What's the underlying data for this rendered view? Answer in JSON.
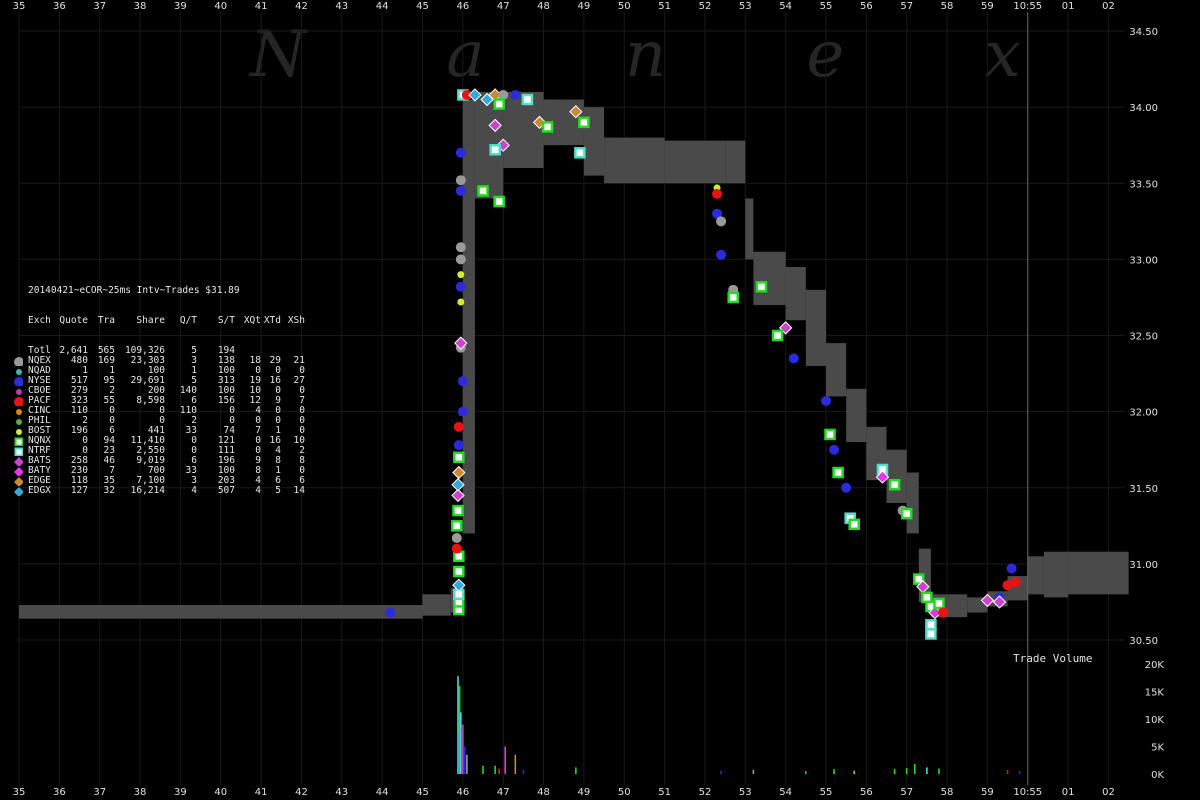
{
  "watermark": "N a n e x",
  "table": {
    "title": "20140421~eCOR~25ms Intv~Trades $31.89",
    "header": [
      "Exch",
      "Quote",
      "Tra",
      "Share",
      "Q/T",
      "S/T",
      "XQt",
      "XTd",
      "XSh"
    ],
    "rows": [
      {
        "name": "Totl",
        "cells": [
          "2,641",
          "565",
          "109,326",
          "5",
          "194",
          "",
          "",
          ""
        ],
        "color": "",
        "shape": "none"
      },
      {
        "name": "NQEX",
        "cells": [
          "480",
          "169",
          "23,303",
          "3",
          "138",
          "18",
          "29",
          "21"
        ],
        "color": "#9a9a9a",
        "shape": "circle-lg"
      },
      {
        "name": "NQAD",
        "cells": [
          "1",
          "1",
          "100",
          "1",
          "100",
          "0",
          "0",
          "0"
        ],
        "color": "#33bbbb",
        "shape": "circle-sm"
      },
      {
        "name": "NYSE",
        "cells": [
          "517",
          "95",
          "29,691",
          "5",
          "313",
          "19",
          "16",
          "27"
        ],
        "color": "#2b2bdd",
        "shape": "circle-lg"
      },
      {
        "name": "CBOE",
        "cells": [
          "279",
          "2",
          "200",
          "140",
          "100",
          "10",
          "0",
          "0"
        ],
        "color": "#aa44aa",
        "shape": "circle-sm"
      },
      {
        "name": "PACF",
        "cells": [
          "323",
          "55",
          "8,598",
          "6",
          "156",
          "12",
          "9",
          "7"
        ],
        "color": "#ee1111",
        "shape": "circle-lg"
      },
      {
        "name": "CINC",
        "cells": [
          "110",
          "0",
          "0",
          "110",
          "0",
          "4",
          "0",
          "0"
        ],
        "color": "#dd8800",
        "shape": "circle-sm"
      },
      {
        "name": "PHIL",
        "cells": [
          "2",
          "0",
          "0",
          "2",
          "0",
          "0",
          "0",
          "0"
        ],
        "color": "#55aa55",
        "shape": "circle-sm"
      },
      {
        "name": "BOST",
        "cells": [
          "196",
          "6",
          "441",
          "33",
          "74",
          "7",
          "1",
          "0"
        ],
        "color": "#ccee33",
        "shape": "circle-sm"
      },
      {
        "name": "NQNX",
        "cells": [
          "0",
          "94",
          "11,410",
          "0",
          "121",
          "0",
          "16",
          "10"
        ],
        "color": "#22dd22",
        "shape": "square"
      },
      {
        "name": "NTRF",
        "cells": [
          "0",
          "23",
          "2,550",
          "0",
          "111",
          "0",
          "4",
          "2"
        ],
        "color": "#55ddcc",
        "shape": "square"
      },
      {
        "name": "BATS",
        "cells": [
          "258",
          "46",
          "9,019",
          "6",
          "196",
          "9",
          "8",
          "8"
        ],
        "color": "#cc44cc",
        "shape": "diamond"
      },
      {
        "name": "BATY",
        "cells": [
          "230",
          "7",
          "700",
          "33",
          "100",
          "8",
          "1",
          "0"
        ],
        "color": "#ee33ee",
        "shape": "diamond"
      },
      {
        "name": "EDGE",
        "cells": [
          "118",
          "35",
          "7,100",
          "3",
          "203",
          "4",
          "6",
          "6"
        ],
        "color": "#cc8833",
        "shape": "diamond"
      },
      {
        "name": "EDGX",
        "cells": [
          "127",
          "32",
          "16,214",
          "4",
          "507",
          "4",
          "5",
          "14"
        ],
        "color": "#33aadd",
        "shape": "diamond"
      }
    ]
  },
  "volume_label": "Trade Volume",
  "chart_data": {
    "type": "scatter",
    "title": "20140421~eCOR~25ms Intv~Trades $31.89",
    "x_tick_labels": [
      "35",
      "36",
      "37",
      "38",
      "39",
      "40",
      "41",
      "42",
      "43",
      "44",
      "45",
      "46",
      "47",
      "48",
      "49",
      "50",
      "51",
      "52",
      "53",
      "54",
      "55",
      "56",
      "57",
      "58",
      "59",
      "10:55",
      "01",
      "02"
    ],
    "x_tick_minutes": [
      -20,
      -19,
      -18,
      -17,
      -16,
      -15,
      -14,
      -13,
      -12,
      -11,
      -10,
      -9,
      -8,
      -7,
      -6,
      -5,
      -4,
      -3,
      -2,
      -1,
      0,
      1,
      2,
      3,
      4,
      5,
      6,
      7
    ],
    "price_ylim": [
      30.5,
      34.5
    ],
    "price_ticks": [
      "30.50",
      "31.00",
      "31.50",
      "32.00",
      "32.50",
      "33.00",
      "33.50",
      "34.00",
      "34.50"
    ],
    "volume_ylim": [
      0,
      20000
    ],
    "volume_ticks": [
      "0K",
      "5K",
      "10K",
      "15K",
      "20K"
    ],
    "nbbo_band": [
      [
        -20,
        30.64,
        30.73
      ],
      [
        -10.8,
        30.64,
        30.73
      ],
      [
        -10.0,
        30.66,
        30.8
      ],
      [
        -9.3,
        30.68,
        30.84
      ],
      [
        -9.0,
        31.2,
        34.05
      ],
      [
        -8.7,
        33.4,
        34.1
      ],
      [
        -8.0,
        33.6,
        34.1
      ],
      [
        -7.0,
        33.75,
        34.05
      ],
      [
        -6.0,
        33.55,
        34.0
      ],
      [
        -5.5,
        33.5,
        33.8
      ],
      [
        -4.0,
        33.5,
        33.78
      ],
      [
        -2.5,
        33.5,
        33.78
      ],
      [
        -2.0,
        33.0,
        33.4
      ],
      [
        -1.8,
        32.7,
        33.05
      ],
      [
        -1.0,
        32.6,
        32.95
      ],
      [
        -0.5,
        32.3,
        32.8
      ],
      [
        0.0,
        32.1,
        32.45
      ],
      [
        0.5,
        31.8,
        32.15
      ],
      [
        1.0,
        31.55,
        31.9
      ],
      [
        1.5,
        31.4,
        31.75
      ],
      [
        2.0,
        31.2,
        31.6
      ],
      [
        2.3,
        30.75,
        31.1
      ],
      [
        2.6,
        30.65,
        30.8
      ],
      [
        3.5,
        30.68,
        30.78
      ],
      [
        4.0,
        30.72,
        30.82
      ],
      [
        4.5,
        30.76,
        30.92
      ],
      [
        5.0,
        30.8,
        31.05
      ],
      [
        5.4,
        30.78,
        31.08
      ],
      [
        6.0,
        30.8,
        31.08
      ],
      [
        7.5,
        30.78,
        31.08
      ]
    ],
    "trades": [
      {
        "t": -10.8,
        "p": 30.68,
        "ex": "NYSE"
      },
      {
        "t": -9.1,
        "p": 30.7,
        "ex": "NQNX"
      },
      {
        "t": -9.1,
        "p": 30.75,
        "ex": "NQNX"
      },
      {
        "t": -9.1,
        "p": 30.8,
        "ex": "NTRF"
      },
      {
        "t": -9.1,
        "p": 30.86,
        "ex": "EDGX"
      },
      {
        "t": -9.1,
        "p": 30.95,
        "ex": "NQNX"
      },
      {
        "t": -9.1,
        "p": 31.05,
        "ex": "NQNX"
      },
      {
        "t": -9.15,
        "p": 31.1,
        "ex": "PACF"
      },
      {
        "t": -9.15,
        "p": 31.17,
        "ex": "NQEX"
      },
      {
        "t": -9.15,
        "p": 31.25,
        "ex": "NQNX"
      },
      {
        "t": -9.12,
        "p": 31.35,
        "ex": "NQNX"
      },
      {
        "t": -9.12,
        "p": 31.45,
        "ex": "BATS"
      },
      {
        "t": -9.12,
        "p": 31.52,
        "ex": "EDGX"
      },
      {
        "t": -9.1,
        "p": 31.6,
        "ex": "EDGE"
      },
      {
        "t": -9.1,
        "p": 31.7,
        "ex": "NQNX"
      },
      {
        "t": -9.1,
        "p": 31.78,
        "ex": "NYSE"
      },
      {
        "t": -9.1,
        "p": 31.9,
        "ex": "PACF"
      },
      {
        "t": -9.0,
        "p": 32.0,
        "ex": "NYSE"
      },
      {
        "t": -9.0,
        "p": 32.2,
        "ex": "NYSE"
      },
      {
        "t": -9.05,
        "p": 32.42,
        "ex": "NQEX"
      },
      {
        "t": -9.05,
        "p": 32.45,
        "ex": "BATS"
      },
      {
        "t": -9.05,
        "p": 32.72,
        "ex": "BOST"
      },
      {
        "t": -9.05,
        "p": 32.82,
        "ex": "NYSE"
      },
      {
        "t": -9.05,
        "p": 32.9,
        "ex": "BOST"
      },
      {
        "t": -9.05,
        "p": 33.0,
        "ex": "NQEX"
      },
      {
        "t": -9.05,
        "p": 33.08,
        "ex": "NQEX"
      },
      {
        "t": -9.05,
        "p": 33.45,
        "ex": "NYSE"
      },
      {
        "t": -9.05,
        "p": 33.52,
        "ex": "NQEX"
      },
      {
        "t": -9.05,
        "p": 33.7,
        "ex": "NYSE"
      },
      {
        "t": -9.0,
        "p": 34.08,
        "ex": "NTRF"
      },
      {
        "t": -8.9,
        "p": 34.08,
        "ex": "PACF"
      },
      {
        "t": -8.7,
        "p": 34.08,
        "ex": "EDGX"
      },
      {
        "t": -8.4,
        "p": 34.05,
        "ex": "EDGX"
      },
      {
        "t": -8.2,
        "p": 34.08,
        "ex": "EDGE"
      },
      {
        "t": -8.0,
        "p": 34.08,
        "ex": "NQEX"
      },
      {
        "t": -7.7,
        "p": 34.08,
        "ex": "NYSE"
      },
      {
        "t": -7.4,
        "p": 34.05,
        "ex": "NTRF"
      },
      {
        "t": -6.2,
        "p": 33.97,
        "ex": "EDGE"
      },
      {
        "t": -6.0,
        "p": 33.9,
        "ex": "NQNX"
      },
      {
        "t": -8.1,
        "p": 34.02,
        "ex": "NQNX"
      },
      {
        "t": -8.2,
        "p": 33.88,
        "ex": "BATS"
      },
      {
        "t": -7.1,
        "p": 33.9,
        "ex": "EDGE"
      },
      {
        "t": -8.0,
        "p": 33.75,
        "ex": "BATS"
      },
      {
        "t": -6.9,
        "p": 33.87,
        "ex": "NQNX"
      },
      {
        "t": -8.1,
        "p": 33.38,
        "ex": "NQNX"
      },
      {
        "t": -8.5,
        "p": 33.45,
        "ex": "NQNX"
      },
      {
        "t": -8.2,
        "p": 33.72,
        "ex": "NTRF"
      },
      {
        "t": -6.1,
        "p": 33.7,
        "ex": "NTRF"
      },
      {
        "t": -2.7,
        "p": 33.47,
        "ex": "BOST"
      },
      {
        "t": -2.7,
        "p": 33.43,
        "ex": "PACF"
      },
      {
        "t": -2.7,
        "p": 33.3,
        "ex": "NYSE"
      },
      {
        "t": -2.6,
        "p": 33.25,
        "ex": "NQEX"
      },
      {
        "t": -2.6,
        "p": 33.03,
        "ex": "NYSE"
      },
      {
        "t": -2.3,
        "p": 32.8,
        "ex": "NQEX"
      },
      {
        "t": -2.3,
        "p": 32.75,
        "ex": "NQNX"
      },
      {
        "t": -1.6,
        "p": 32.82,
        "ex": "NQNX"
      },
      {
        "t": -1.0,
        "p": 32.55,
        "ex": "BATS"
      },
      {
        "t": -1.2,
        "p": 32.5,
        "ex": "NQNX"
      },
      {
        "t": -0.8,
        "p": 32.35,
        "ex": "NYSE"
      },
      {
        "t": 0.0,
        "p": 32.07,
        "ex": "NYSE"
      },
      {
        "t": 0.1,
        "p": 31.85,
        "ex": "NQNX"
      },
      {
        "t": 0.2,
        "p": 31.75,
        "ex": "NYSE"
      },
      {
        "t": 0.3,
        "p": 31.6,
        "ex": "NQNX"
      },
      {
        "t": 0.5,
        "p": 31.5,
        "ex": "NYSE"
      },
      {
        "t": 0.6,
        "p": 31.3,
        "ex": "NTRF"
      },
      {
        "t": 0.7,
        "p": 31.26,
        "ex": "NQNX"
      },
      {
        "t": 1.4,
        "p": 31.62,
        "ex": "NTRF"
      },
      {
        "t": 1.4,
        "p": 31.57,
        "ex": "BATY"
      },
      {
        "t": 1.7,
        "p": 31.52,
        "ex": "NQNX"
      },
      {
        "t": 1.9,
        "p": 31.35,
        "ex": "NQEX"
      },
      {
        "t": 2.0,
        "p": 31.33,
        "ex": "NQNX"
      },
      {
        "t": 2.3,
        "p": 30.9,
        "ex": "NQNX"
      },
      {
        "t": 2.4,
        "p": 30.85,
        "ex": "BATS"
      },
      {
        "t": 2.5,
        "p": 30.78,
        "ex": "NQNX"
      },
      {
        "t": 2.6,
        "p": 30.72,
        "ex": "NQNX"
      },
      {
        "t": 2.7,
        "p": 30.68,
        "ex": "BATS"
      },
      {
        "t": 2.6,
        "p": 30.6,
        "ex": "NTRF"
      },
      {
        "t": 2.6,
        "p": 30.54,
        "ex": "NTRF"
      },
      {
        "t": 2.8,
        "p": 30.74,
        "ex": "NQNX"
      },
      {
        "t": 2.9,
        "p": 30.68,
        "ex": "PACF"
      },
      {
        "t": 4.0,
        "p": 30.76,
        "ex": "BATS"
      },
      {
        "t": 4.3,
        "p": 30.78,
        "ex": "NYSE"
      },
      {
        "t": 4.5,
        "p": 30.86,
        "ex": "PACF"
      },
      {
        "t": 4.7,
        "p": 30.88,
        "ex": "PACF"
      },
      {
        "t": 4.6,
        "p": 30.97,
        "ex": "NYSE"
      },
      {
        "t": 4.3,
        "p": 30.75,
        "ex": "BATS"
      }
    ],
    "volume_bars": [
      {
        "t": -9.12,
        "v": 17800,
        "ex": "NTRF"
      },
      {
        "t": -9.08,
        "v": 16000,
        "ex": "NQNX"
      },
      {
        "t": -9.05,
        "v": 11200,
        "ex": "NTRF"
      },
      {
        "t": -9.0,
        "v": 9000,
        "ex": "BATS"
      },
      {
        "t": -9.1,
        "v": 7500,
        "ex": "EDGX"
      },
      {
        "t": -8.95,
        "v": 5000,
        "ex": "NYSE"
      },
      {
        "t": -8.9,
        "v": 3500,
        "ex": "NQEX"
      },
      {
        "t": -7.95,
        "v": 5000,
        "ex": "BATY"
      },
      {
        "t": -7.7,
        "v": 3500,
        "ex": "EDGE"
      },
      {
        "t": -8.5,
        "v": 1500,
        "ex": "NQNX"
      },
      {
        "t": -8.2,
        "v": 1500,
        "ex": "NQNX"
      },
      {
        "t": -8.1,
        "v": 1000,
        "ex": "PACF"
      },
      {
        "t": -6.2,
        "v": 1200,
        "ex": "NQNX"
      },
      {
        "t": -7.5,
        "v": 800,
        "ex": "NYSE"
      },
      {
        "t": -2.6,
        "v": 600,
        "ex": "NYSE"
      },
      {
        "t": -1.8,
        "v": 800,
        "ex": "NQEX"
      },
      {
        "t": -0.5,
        "v": 500,
        "ex": "NQNX"
      },
      {
        "t": 0.2,
        "v": 900,
        "ex": "NQNX"
      },
      {
        "t": 0.7,
        "v": 600,
        "ex": "NTRF"
      },
      {
        "t": 1.7,
        "v": 900,
        "ex": "NQNX"
      },
      {
        "t": 2.0,
        "v": 1100,
        "ex": "NQNX"
      },
      {
        "t": 2.2,
        "v": 1800,
        "ex": "NQNX"
      },
      {
        "t": 2.5,
        "v": 1200,
        "ex": "NTRF"
      },
      {
        "t": 2.8,
        "v": 1000,
        "ex": "NQNX"
      },
      {
        "t": 4.5,
        "v": 700,
        "ex": "PACF"
      },
      {
        "t": 4.8,
        "v": 500,
        "ex": "NYSE"
      }
    ],
    "grid": true,
    "legend": "left"
  }
}
